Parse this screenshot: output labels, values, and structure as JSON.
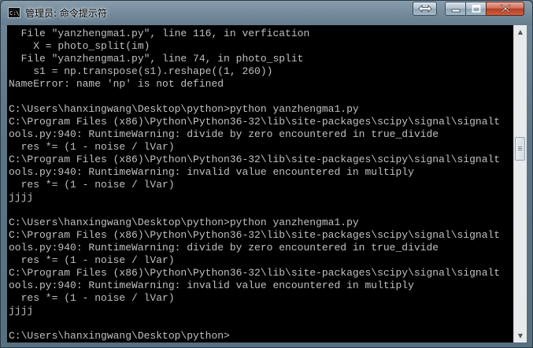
{
  "window": {
    "title": "管理员: 命令提示符",
    "icon": "cmd-icon",
    "controls": {
      "resize": "resize-icon",
      "minimize": "minimize-icon",
      "maximize": "maximize-icon",
      "close": "close-icon"
    }
  },
  "console": {
    "lines": [
      "  File \"yanzhengma1.py\", line 116, in verfication",
      "    X = photo_split(im)",
      "  File \"yanzhengma1.py\", line 74, in photo_split",
      "    s1 = np.transpose(s1).reshape((1, 260))",
      "NameError: name 'np' is not defined",
      "",
      "C:\\Users\\hanxingwang\\Desktop\\python>python yanzhengma1.py",
      "C:\\Program Files (x86)\\Python\\Python36-32\\lib\\site-packages\\scipy\\signal\\signalt",
      "ools.py:940: RuntimeWarning: divide by zero encountered in true_divide",
      "  res *= (1 - noise / lVar)",
      "C:\\Program Files (x86)\\Python\\Python36-32\\lib\\site-packages\\scipy\\signal\\signalt",
      "ools.py:940: RuntimeWarning: invalid value encountered in multiply",
      "  res *= (1 - noise / lVar)",
      "jjjj",
      "",
      "C:\\Users\\hanxingwang\\Desktop\\python>python yanzhengma1.py",
      "C:\\Program Files (x86)\\Python\\Python36-32\\lib\\site-packages\\scipy\\signal\\signalt",
      "ools.py:940: RuntimeWarning: divide by zero encountered in true_divide",
      "  res *= (1 - noise / lVar)",
      "C:\\Program Files (x86)\\Python\\Python36-32\\lib\\site-packages\\scipy\\signal\\signalt",
      "ools.py:940: RuntimeWarning: invalid value encountered in multiply",
      "  res *= (1 - noise / lVar)",
      "jjjj",
      "",
      "C:\\Users\\hanxingwang\\Desktop\\python>"
    ]
  },
  "colors": {
    "console_bg": "#000000",
    "console_text": "#c0c0c0"
  }
}
